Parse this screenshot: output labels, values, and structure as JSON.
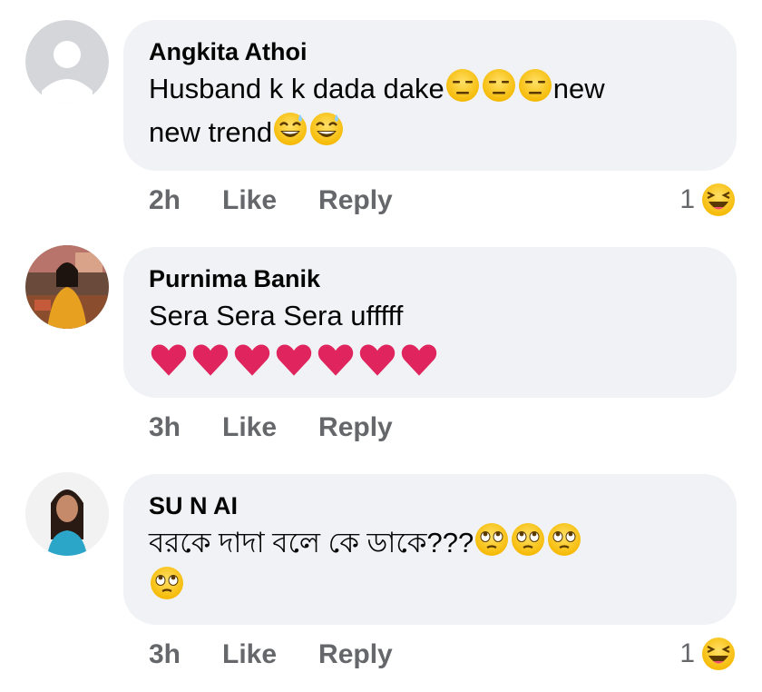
{
  "comments": [
    {
      "author": "Angkita Athoi",
      "text_line1": "Husband k k dada dake",
      "text_line1_tail": "new",
      "text_line2": "new trend",
      "time": "2h",
      "like": "Like",
      "reply": "Reply",
      "reaction_count": "1",
      "reaction_icon": "haha-icon",
      "emoji_line1": [
        "expressionless-face-icon",
        "expressionless-face-icon",
        "expressionless-face-icon"
      ],
      "emoji_line2": [
        "grinning-sweat-face-icon",
        "grinning-sweat-face-icon"
      ],
      "avatar": "default-avatar-icon"
    },
    {
      "author": "Purnima Banik",
      "text_line1": "Sera Sera Sera ufffff",
      "hearts": 7,
      "time": "3h",
      "like": "Like",
      "reply": "Reply",
      "avatar": "profile-photo"
    },
    {
      "author": "SU N AI",
      "text_line1": "বরকে দাদা বলে কে ডাকে???",
      "emoji_line1": [
        "rolling-eyes-face-icon",
        "rolling-eyes-face-icon",
        "rolling-eyes-face-icon"
      ],
      "emoji_line2": [
        "rolling-eyes-face-icon"
      ],
      "time": "3h",
      "like": "Like",
      "reply": "Reply",
      "reaction_count": "1",
      "reaction_icon": "haha-icon",
      "avatar": "profile-photo"
    }
  ],
  "colors": {
    "bubble": "#f0f2f5",
    "meta": "#65676b",
    "heart": "#e0245e"
  }
}
